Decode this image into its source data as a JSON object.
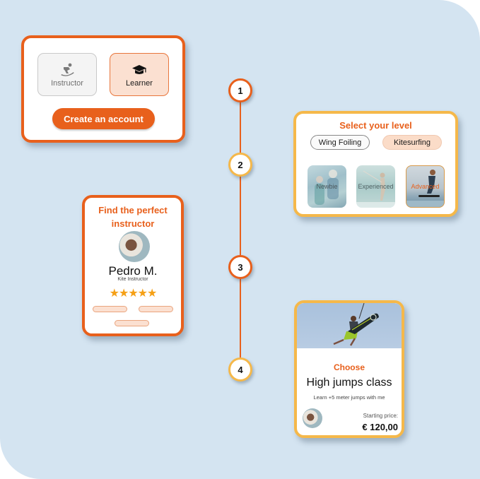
{
  "colors": {
    "background": "#d4e4f1",
    "accent_orange": "#e8601c",
    "accent_yellow": "#f5b84a",
    "star": "#f5a016"
  },
  "step1_card": {
    "roles": [
      {
        "label": "Instructor",
        "icon": "snowboarder-icon",
        "selected": false
      },
      {
        "label": "Learner",
        "icon": "graduation-cap-icon",
        "selected": true
      }
    ],
    "create_button": "Create an account"
  },
  "timeline": {
    "steps": [
      "1",
      "2",
      "3",
      "4"
    ]
  },
  "step2_card": {
    "title": "Select your level",
    "sports": [
      {
        "label": "Wing Foiling",
        "selected": false
      },
      {
        "label": "Kitesurfing",
        "selected": true
      }
    ],
    "levels": [
      {
        "label": "Newbie",
        "selected": false
      },
      {
        "label": "Experienced",
        "selected": false
      },
      {
        "label": "Advanced",
        "selected": true
      }
    ]
  },
  "step3_card": {
    "title": "Find the perfect instructor",
    "name": "Pedro M.",
    "role": "Kite Instructor",
    "rating": 5,
    "stars": "★★★★★"
  },
  "step4_card": {
    "choose": "Choose",
    "class_title": "High jumps class",
    "description": "Learn +5 meter jumps with me",
    "price_label": "Starting price:",
    "price": "€ 120,00"
  }
}
